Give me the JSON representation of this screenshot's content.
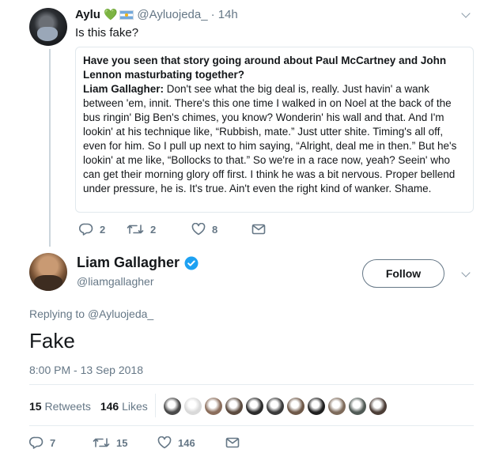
{
  "parent_tweet": {
    "author_name": "Aylu",
    "heart_emoji": "💚",
    "handle": "@Ayluojeda_",
    "time": "· 14h",
    "text": "Is this fake?",
    "quote": {
      "title": "Have you seen that story going around about Paul McCartney and John Lennon masturbating together?",
      "speaker": "Liam Gallagher:",
      "body": " Don't see what the big deal is, really. Just havin' a wank between 'em, innit. There's this one time I walked in on Noel at the back of the bus ringin' Big Ben's chimes, you know? Wonderin' his wall and that. And I'm lookin' at his technique like, “Rubbish, mate.” Just utter shite. Timing's all off, even for him. So I pull up next to him saying, “Alright, deal me in then.” But he's lookin' at me like, “Bollocks to that.” So we're in a race now, yeah? Seein' who can get their morning glory off first. I think he was a bit nervous. Proper bellend under pressure, he is. It's true. Ain't even the right kind of wanker. Shame."
    },
    "actions": {
      "replies": "2",
      "retweets": "2",
      "likes": "8"
    }
  },
  "main_tweet": {
    "author_name": "Liam Gallagher",
    "handle": "@liamgallagher",
    "follow_label": "Follow",
    "replying_prefix": "Replying to ",
    "replying_to": "@Ayluojeda_",
    "text": "Fake",
    "timestamp": "8:00 PM - 13 Sep 2018",
    "stats": {
      "retweets_count": "15",
      "retweets_label": "Retweets",
      "likes_count": "146",
      "likes_label": "Likes"
    },
    "liker_colors": [
      "#4a4a4a",
      "#d9d9d9",
      "#8a6d5b",
      "#5b4a3e",
      "#2b2b2b",
      "#3a3a3a",
      "#6e5848",
      "#1f1f1f",
      "#7d6a5a",
      "#505a55",
      "#4b3d36"
    ],
    "actions": {
      "replies": "7",
      "retweets": "15",
      "likes": "146"
    }
  },
  "colors": {
    "verified": "#1da1f2",
    "muted": "#657786",
    "text": "#14171a",
    "heart": "#77b255"
  }
}
